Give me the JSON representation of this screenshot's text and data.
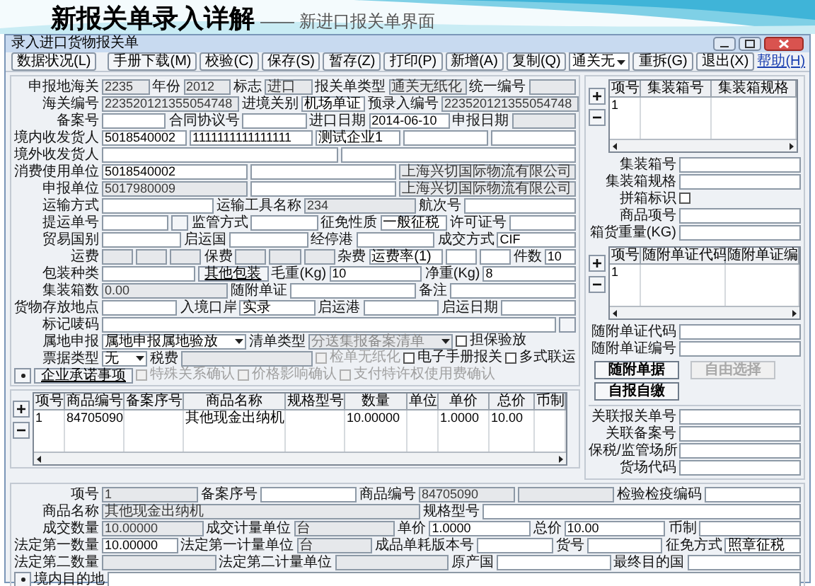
{
  "slide": {
    "title": "新报关单录入详解",
    "subtitle": "—— 新进口报关单界面"
  },
  "window": {
    "title": "录入进口货物报关单"
  },
  "toolbar": {
    "status_button": "数据状况(L)",
    "buttons": [
      "手册下载(M)",
      "校验(C)",
      "保存(S)",
      "暂存(Z)",
      "打印(P)",
      "新增(A)",
      "复制(Q)"
    ],
    "combo": "通关无",
    "buttons_after": [
      "重拆(G)",
      "退出(X)"
    ],
    "help_link": "帮助(H)"
  },
  "header_form": {
    "rows": [
      {
        "items": [
          {
            "kind": "label",
            "text": "申报地海关"
          },
          {
            "kind": "field",
            "value": "2235",
            "readonly": true
          },
          {
            "kind": "label",
            "text": "年份"
          },
          {
            "kind": "field",
            "value": "2012",
            "readonly": true
          },
          {
            "kind": "label",
            "text": "标志"
          },
          {
            "kind": "field",
            "value": "进口",
            "readonly": true
          },
          {
            "kind": "label",
            "text": "报关单类型"
          },
          {
            "kind": "field",
            "value": "通关无纸化",
            "readonly": true
          },
          {
            "kind": "label",
            "text": "统一编号"
          },
          {
            "kind": "field",
            "readonly": true
          }
        ]
      },
      {
        "items": [
          {
            "kind": "label",
            "text": "海关编号"
          },
          {
            "kind": "field",
            "value": "223520121355054748",
            "readonly": true
          },
          {
            "kind": "label",
            "text": "进境关别"
          },
          {
            "kind": "field",
            "value": "机场单证",
            "readonly": false
          },
          {
            "kind": "label",
            "text": "预录入编号"
          },
          {
            "kind": "field",
            "value": "223520121355054748",
            "readonly": true
          }
        ]
      },
      {
        "items": [
          {
            "kind": "label",
            "text": "备案号"
          },
          {
            "kind": "field",
            "readonly": false
          },
          {
            "kind": "label",
            "text": "合同协议号"
          },
          {
            "kind": "field",
            "readonly": false
          },
          {
            "kind": "label",
            "text": "进口日期"
          },
          {
            "kind": "field",
            "value": "2014-06-10",
            "readonly": false
          },
          {
            "kind": "label",
            "text": "申报日期"
          },
          {
            "kind": "field",
            "readonly": true
          }
        ]
      },
      {
        "items": [
          {
            "kind": "label",
            "text": "境内收发货人"
          },
          {
            "kind": "field",
            "value": "5018540002",
            "readonly": false
          },
          {
            "kind": "field",
            "value": "1111111111111111",
            "readonly": false
          },
          {
            "kind": "field",
            "value": "测试企业1",
            "readonly": false
          },
          {
            "kind": "field",
            "readonly": false
          },
          {
            "kind": "field",
            "readonly": false
          }
        ]
      },
      {
        "items": [
          {
            "kind": "label",
            "text": "境外收发货人"
          },
          {
            "kind": "field",
            "readonly": false
          },
          {
            "kind": "field",
            "readonly": false
          }
        ]
      },
      {
        "items": [
          {
            "kind": "label",
            "text": "消费使用单位"
          },
          {
            "kind": "field",
            "value": "5018540002",
            "readonly": false
          },
          {
            "kind": "field",
            "readonly": false
          },
          {
            "kind": "field",
            "value": "上海兴切国际物流有限公司",
            "readonly": true
          }
        ]
      },
      {
        "items": [
          {
            "kind": "label",
            "text": "申报单位"
          },
          {
            "kind": "field",
            "value": "5017980009",
            "readonly": true
          },
          {
            "kind": "field",
            "readonly": false
          },
          {
            "kind": "field",
            "value": "上海兴切国际物流有限公司",
            "readonly": true
          }
        ]
      },
      {
        "items": [
          {
            "kind": "label",
            "text": "运输方式"
          },
          {
            "kind": "field",
            "readonly": false
          },
          {
            "kind": "label",
            "text": "运输工具名称"
          },
          {
            "kind": "field",
            "value": "234",
            "readonly": true
          },
          {
            "kind": "label",
            "text": "航次号"
          },
          {
            "kind": "field",
            "readonly": false
          }
        ]
      },
      {
        "items": [
          {
            "kind": "label",
            "text": "提运单号"
          },
          {
            "kind": "field",
            "readonly": false
          },
          {
            "kind": "browse"
          },
          {
            "kind": "label",
            "text": "监管方式"
          },
          {
            "kind": "field",
            "readonly": false
          },
          {
            "kind": "label",
            "text": "征免性质"
          },
          {
            "kind": "field",
            "value": "一般征税",
            "readonly": false
          },
          {
            "kind": "label",
            "text": "许可证号"
          },
          {
            "kind": "field",
            "readonly": false
          }
        ]
      },
      {
        "items": [
          {
            "kind": "label",
            "text": "贸易国别"
          },
          {
            "kind": "field",
            "readonly": false
          },
          {
            "kind": "label",
            "text": "启运国"
          },
          {
            "kind": "field",
            "readonly": false
          },
          {
            "kind": "label",
            "text": "经停港"
          },
          {
            "kind": "field",
            "readonly": false
          },
          {
            "kind": "label",
            "text": "成交方式"
          },
          {
            "kind": "field",
            "value": "CIF",
            "readonly": false
          }
        ]
      },
      {
        "items": [
          {
            "kind": "label",
            "text": "运费"
          },
          {
            "kind": "field",
            "readonly": true
          },
          {
            "kind": "field",
            "readonly": true
          },
          {
            "kind": "field",
            "readonly": true
          },
          {
            "kind": "label",
            "text": "保费"
          },
          {
            "kind": "field",
            "readonly": true
          },
          {
            "kind": "field",
            "readonly": true
          },
          {
            "kind": "field",
            "readonly": true
          },
          {
            "kind": "label",
            "text": "杂费"
          },
          {
            "kind": "field",
            "value": "运费率(1)",
            "readonly": false
          },
          {
            "kind": "field",
            "readonly": false
          },
          {
            "kind": "field",
            "readonly": false
          },
          {
            "kind": "label",
            "text": "件数"
          },
          {
            "kind": "field",
            "value": "10",
            "readonly": false
          }
        ]
      },
      {
        "items": [
          {
            "kind": "label",
            "text": "包装种类"
          },
          {
            "kind": "field",
            "readonly": false
          },
          {
            "kind": "button",
            "label": "其他包装"
          },
          {
            "kind": "label",
            "text": "毛重(Kg)"
          },
          {
            "kind": "field",
            "value": "10",
            "readonly": false
          },
          {
            "kind": "label",
            "text": "净重(Kg)"
          },
          {
            "kind": "field",
            "value": "8",
            "readonly": false
          }
        ]
      },
      {
        "items": [
          {
            "kind": "label",
            "text": "集装箱数"
          },
          {
            "kind": "field",
            "value": "0.00",
            "readonly": true
          },
          {
            "kind": "label",
            "text": "随附单证"
          },
          {
            "kind": "field",
            "readonly": false
          },
          {
            "kind": "label",
            "text": "备注"
          },
          {
            "kind": "field",
            "readonly": false
          }
        ]
      },
      {
        "items": [
          {
            "kind": "label",
            "text": "货物存放地点"
          },
          {
            "kind": "field",
            "readonly": false
          },
          {
            "kind": "label",
            "text": "入境口岸"
          },
          {
            "kind": "field",
            "value": "实录",
            "readonly": false
          },
          {
            "kind": "label",
            "text": "启运港"
          },
          {
            "kind": "field",
            "readonly": false
          },
          {
            "kind": "label",
            "text": "启运日期"
          },
          {
            "kind": "field",
            "readonly": false
          }
        ]
      },
      {
        "items": [
          {
            "kind": "label",
            "text": "标记唛码"
          },
          {
            "kind": "field",
            "readonly": false
          },
          {
            "kind": "browse"
          }
        ]
      },
      {
        "items": [
          {
            "kind": "label",
            "text": "属地申报"
          },
          {
            "kind": "combo",
            "value": "属地申报属地验放",
            "readonly": false
          },
          {
            "kind": "label",
            "text": "清单类型"
          },
          {
            "kind": "combo",
            "value": "分送集报备案清单",
            "readonly": true
          },
          {
            "kind": "check",
            "label": "担保验放",
            "checked": false,
            "disabled": false
          }
        ]
      },
      {
        "items": [
          {
            "kind": "label",
            "text": "票据类型"
          },
          {
            "kind": "combo",
            "value": "无",
            "readonly": false
          },
          {
            "kind": "label",
            "text": "税费"
          },
          {
            "kind": "field",
            "readonly": true
          },
          {
            "kind": "check",
            "label": "检单无纸化",
            "checked": false,
            "disabled": true
          },
          {
            "kind": "check",
            "label": "电子手册报关",
            "checked": false,
            "disabled": false
          },
          {
            "kind": "check",
            "label": "多式联运",
            "checked": false,
            "disabled": false
          }
        ]
      },
      {
        "items": [
          {
            "kind": "dot"
          },
          {
            "kind": "button",
            "label": "企业承诺事项"
          },
          {
            "kind": "check",
            "label": "特殊关系确认",
            "checked": false,
            "disabled": true
          },
          {
            "kind": "check",
            "label": "价格影响确认",
            "checked": false,
            "disabled": true
          },
          {
            "kind": "check",
            "label": "支付特许权使用费确认",
            "checked": false,
            "disabled": true
          }
        ]
      }
    ]
  },
  "goods_grid": {
    "columns": [
      "项号",
      "商品编号",
      "备案序号",
      "商品名称",
      "规格型号",
      "数量",
      "单位",
      "单价",
      "总价",
      "币制"
    ],
    "rows": [
      [
        "1",
        "84705090",
        null,
        "其他现金出纳机",
        null,
        "10.00000",
        null,
        "1.0000",
        "10.00",
        null
      ]
    ]
  },
  "goods_form": {
    "rows": [
      {
        "items": [
          {
            "kind": "label",
            "text": "项号"
          },
          {
            "kind": "field",
            "value": "1",
            "readonly": true
          },
          {
            "kind": "label",
            "text": "备案序号"
          },
          {
            "kind": "field",
            "readonly": false
          },
          {
            "kind": "label",
            "text": "商品编号"
          },
          {
            "kind": "field",
            "value": "84705090",
            "readonly": true
          },
          {
            "kind": "field",
            "readonly": true
          },
          {
            "kind": "label",
            "text": "检验检疫编码"
          },
          {
            "kind": "field",
            "readonly": false
          }
        ]
      },
      {
        "items": [
          {
            "kind": "label",
            "text": "商品名称"
          },
          {
            "kind": "field",
            "value": "其他现金出纳机",
            "readonly": true
          },
          {
            "kind": "label",
            "text": "规格型号"
          },
          {
            "kind": "field",
            "readonly": false
          }
        ]
      },
      {
        "items": [
          {
            "kind": "label",
            "text": "成交数量"
          },
          {
            "kind": "field",
            "value": "10.00000",
            "readonly": true
          },
          {
            "kind": "label",
            "text": "成交计量单位"
          },
          {
            "kind": "field",
            "value": "台",
            "readonly": true
          },
          {
            "kind": "label",
            "text": "单价"
          },
          {
            "kind": "field",
            "value": "1.0000",
            "readonly": false
          },
          {
            "kind": "label",
            "text": "总价"
          },
          {
            "kind": "field",
            "value": "10.00",
            "readonly": false
          },
          {
            "kind": "label",
            "text": "币制"
          },
          {
            "kind": "field",
            "readonly": false
          }
        ]
      },
      {
        "items": [
          {
            "kind": "label",
            "text": "法定第一数量"
          },
          {
            "kind": "field",
            "value": "10.00000",
            "readonly": false
          },
          {
            "kind": "label",
            "text": "法定第一计量单位"
          },
          {
            "kind": "field",
            "value": "台",
            "readonly": true
          },
          {
            "kind": "label",
            "text": "成品单耗版本号"
          },
          {
            "kind": "field",
            "readonly": false
          },
          {
            "kind": "label",
            "text": "货号"
          },
          {
            "kind": "field",
            "readonly": false
          },
          {
            "kind": "label",
            "text": "征免方式"
          },
          {
            "kind": "field",
            "value": "照章征税",
            "readonly": false
          }
        ]
      },
      {
        "items": [
          {
            "kind": "label",
            "text": "法定第二数量"
          },
          {
            "kind": "field",
            "readonly": true
          },
          {
            "kind": "label",
            "text": "法定第二计量单位"
          },
          {
            "kind": "field",
            "readonly": true
          },
          {
            "kind": "label",
            "text": "原产国"
          },
          {
            "kind": "field",
            "readonly": false
          },
          {
            "kind": "label",
            "text": "最终目的国"
          },
          {
            "kind": "field",
            "readonly": false
          }
        ]
      },
      {
        "items": [
          {
            "kind": "dot"
          },
          {
            "kind": "label",
            "text": "境内目的地"
          },
          {
            "kind": "field",
            "readonly": false
          }
        ]
      }
    ]
  },
  "container_grid": {
    "columns": [
      "项号",
      "集装箱号",
      "集装箱规格"
    ],
    "rows": [
      [
        "1",
        null,
        null
      ]
    ]
  },
  "container_form": {
    "rows": [
      {
        "items": [
          {
            "kind": "label",
            "text": "集装箱号"
          },
          {
            "kind": "field",
            "readonly": false
          }
        ]
      },
      {
        "items": [
          {
            "kind": "label",
            "text": "集装箱规格"
          },
          {
            "kind": "field",
            "readonly": false
          }
        ]
      },
      {
        "items": [
          {
            "kind": "label",
            "text": "拼箱标识"
          },
          {
            "kind": "check",
            "checked": false,
            "disabled": false
          }
        ]
      },
      {
        "items": [
          {
            "kind": "label",
            "text": "商品项号"
          },
          {
            "kind": "field",
            "readonly": false
          }
        ]
      },
      {
        "items": [
          {
            "kind": "label",
            "text": "箱货重量(KG)"
          },
          {
            "kind": "field",
            "readonly": false
          }
        ]
      }
    ]
  },
  "document_grid": {
    "columns": [
      "项号",
      "随附单证代码",
      "随附单证编"
    ],
    "rows": [
      [
        "1",
        null,
        null
      ]
    ]
  },
  "document_form": {
    "rows": [
      {
        "items": [
          {
            "kind": "label",
            "text": "随附单证代码"
          },
          {
            "kind": "field",
            "readonly": false
          }
        ]
      },
      {
        "items": [
          {
            "kind": "label",
            "text": "随附单证编号"
          },
          {
            "kind": "field",
            "readonly": false
          }
        ]
      }
    ]
  },
  "side_buttons": [
    {
      "label": "随附单据",
      "disabled": false
    },
    {
      "label": "自由选择",
      "disabled": true
    },
    {
      "label": "自报自缴",
      "disabled": false
    }
  ],
  "relation_form": {
    "rows": [
      {
        "items": [
          {
            "kind": "label",
            "text": "关联报关单号"
          },
          {
            "kind": "field",
            "readonly": false
          }
        ]
      },
      {
        "items": [
          {
            "kind": "label",
            "text": "关联备案号"
          },
          {
            "kind": "field",
            "readonly": false
          }
        ]
      },
      {
        "items": [
          {
            "kind": "label",
            "text": "保税/监管场所"
          },
          {
            "kind": "field",
            "readonly": false
          }
        ]
      },
      {
        "items": [
          {
            "kind": "label",
            "text": "货场代码"
          },
          {
            "kind": "field",
            "readonly": false
          }
        ]
      }
    ]
  }
}
